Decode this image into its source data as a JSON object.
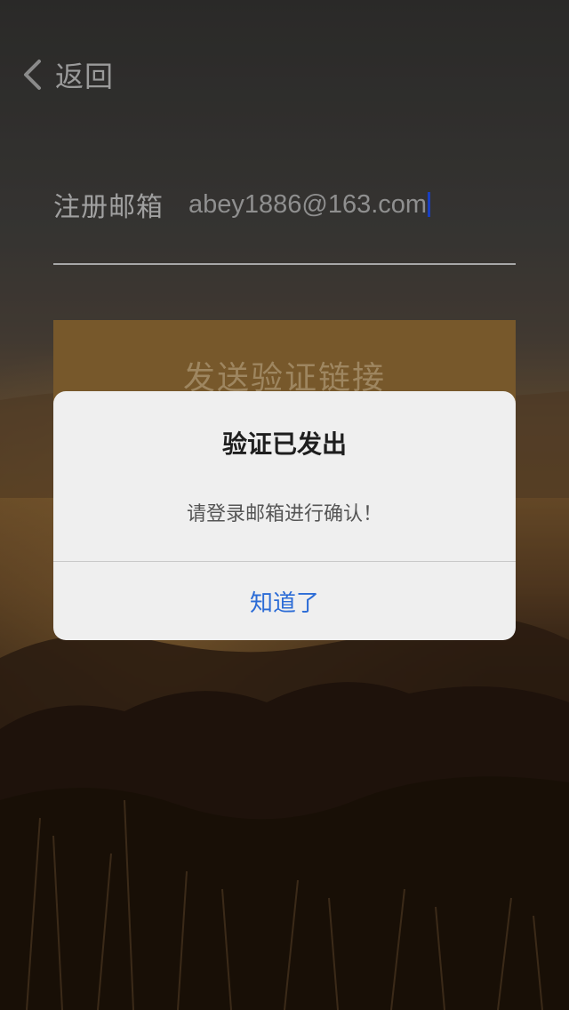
{
  "nav": {
    "back_label": "返回"
  },
  "form": {
    "email_label": "注册邮箱",
    "email_value": "abey1886@163.com",
    "send_button_label": "发送验证链接"
  },
  "dialog": {
    "title": "验证已发出",
    "message": "请登录邮箱进行确认！",
    "confirm_label": "知道了"
  },
  "colors": {
    "accent_button": "#77582b",
    "dialog_link": "#2c6cd6",
    "caret": "#1a3fbf"
  },
  "icons": {
    "back": "chevron-left-icon"
  }
}
